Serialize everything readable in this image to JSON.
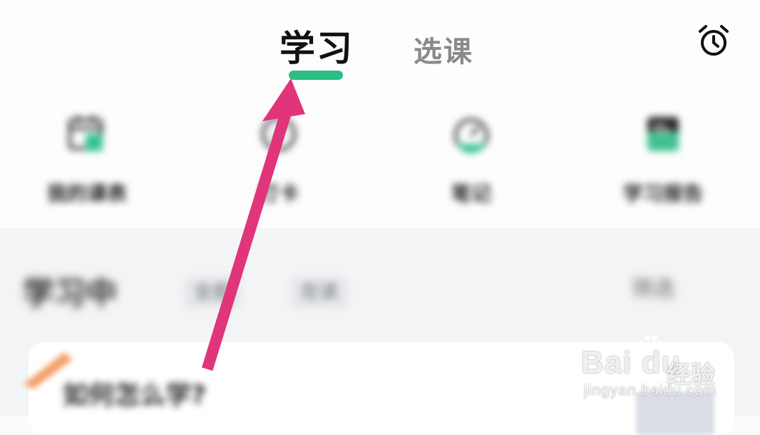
{
  "header": {
    "tabs": [
      {
        "label": "学习",
        "active": true
      },
      {
        "label": "选课",
        "active": false
      }
    ],
    "alarm_icon": "alarm-clock-icon",
    "accent_color": "#2bbd85"
  },
  "quick_actions": [
    {
      "icon": "calendar-icon",
      "label": "我的课表"
    },
    {
      "icon": "check-circle-icon",
      "label": "打卡"
    },
    {
      "icon": "timer-icon",
      "label": "笔记"
    },
    {
      "icon": "notebook-icon",
      "label": "学习报告"
    }
  ],
  "section": {
    "title": "学习中",
    "filters": [
      "全部",
      "在读"
    ],
    "sort_label": "筛选"
  },
  "course_card": {
    "title": "如何怎么学?"
  },
  "annotation": {
    "arrow_color": "#e0357a"
  },
  "watermark": {
    "brand": "Bai du",
    "sub": "经验",
    "url": "jingyan.baidu.com"
  }
}
